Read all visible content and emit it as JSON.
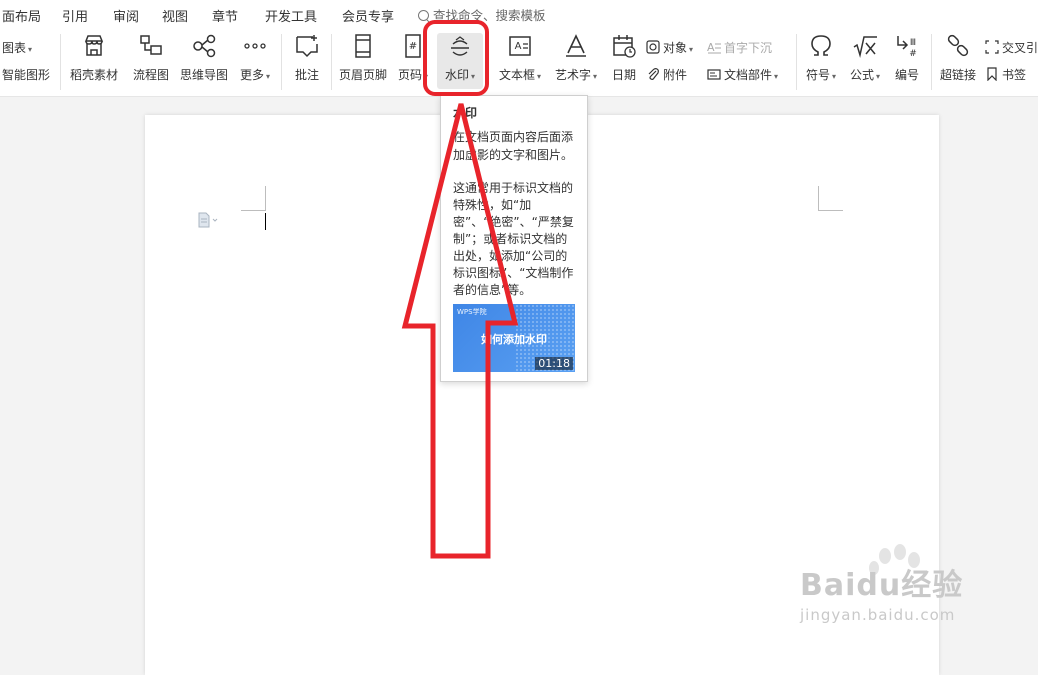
{
  "menu": {
    "items": [
      "面布局",
      "引用",
      "审阅",
      "视图",
      "章节",
      "开发工具",
      "会员专享"
    ],
    "search_text": "查找命令、搜索模板"
  },
  "ribbon": {
    "chart_label": "图表",
    "smart_shape_label": "智能图形",
    "resources_label": "稻壳素材",
    "flowchart_label": "流程图",
    "mindmap_label": "思维导图",
    "more_label": "更多",
    "comment_label": "批注",
    "header_footer_label": "页眉页脚",
    "page_number_label": "页码",
    "watermark_label": "水印",
    "textbox_label": "文本框",
    "wordart_label": "艺术字",
    "date_label": "日期",
    "object_label": "对象",
    "attachment_label": "附件",
    "dropcap_label": "首字下沉",
    "doc_parts_label": "文档部件",
    "symbol_label": "符号",
    "formula_label": "公式",
    "numbering_label": "编号",
    "hyperlink_label": "超链接",
    "crossref_label": "交叉引",
    "bookmark_label": "书签"
  },
  "tooltip": {
    "title": "水印",
    "desc1": "在文档页面内容后面添加虚影的文字和图片。",
    "desc2": "这通常用于标识文档的特殊性，如“加密”、“绝密”、“严禁复制”；或者标识文档的出处，如添加“公司的标识图标”、“文档制作者的信息”等。",
    "video_logo": "WPS学院",
    "video_title": "如何添加水印",
    "video_duration": "01:18"
  },
  "watermark_site": {
    "brand": "Baidu经验",
    "url": "jingyan.baidu.com"
  },
  "colors": {
    "highlight": "#e8242b",
    "video_bg": "#4a90e2"
  }
}
